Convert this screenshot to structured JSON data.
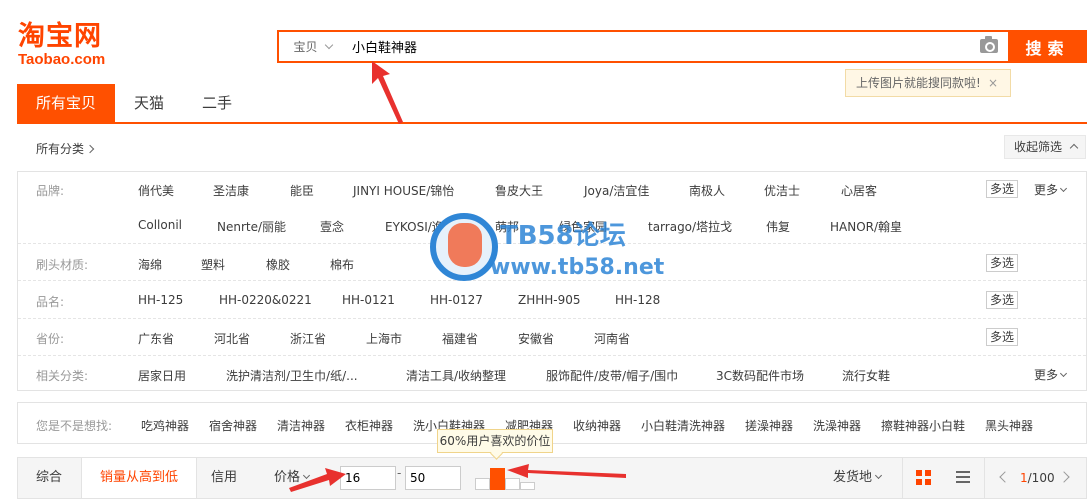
{
  "logo": {
    "cn": "淘宝网",
    "en": "Taobao.com"
  },
  "search": {
    "scope": "宝贝",
    "query": "小白鞋神器",
    "button": "搜索",
    "image_tip": "上传图片就能搜同款啦!",
    "tip_close": "×"
  },
  "tabs": [
    {
      "label": "所有宝贝",
      "active": true
    },
    {
      "label": "天猫",
      "active": false
    },
    {
      "label": "二手",
      "active": false
    }
  ],
  "breadcrumb": "所有分类",
  "collapse_label": "收起筛选",
  "filters": {
    "multi_label": "多选",
    "more_label": "更多",
    "brand": {
      "label": "品牌:",
      "row1": [
        "俏代美",
        "圣洁康",
        "能臣",
        "JINYI HOUSE/锦怡",
        "鲁皮大王",
        "Joya/洁宜佳",
        "南极人",
        "优洁士",
        "心居客"
      ],
      "row2": [
        "Collonil",
        "Nenrte/丽能",
        "壹念",
        "EYKOSI/逸柯",
        "萌邦",
        "绿色家园",
        "tarrago/塔拉戈",
        "伟复",
        "HANOR/翰皇"
      ]
    },
    "material": {
      "label": "刷头材质:",
      "items": [
        "海绵",
        "塑料",
        "橡胶",
        "棉布"
      ]
    },
    "product": {
      "label": "品名:",
      "items": [
        "HH-125",
        "HH-0220&0221",
        "HH-0121",
        "HH-0127",
        "ZHHH-905",
        "HH-128"
      ]
    },
    "province": {
      "label": "省份:",
      "items": [
        "广东省",
        "河北省",
        "浙江省",
        "上海市",
        "福建省",
        "安徽省",
        "河南省"
      ]
    },
    "category": {
      "label": "相关分类:",
      "items": [
        "居家日用",
        "洗护清洁剂/卫生巾/纸/...",
        "清洁工具/收纳整理",
        "服饰配件/皮带/帽子/围巾",
        "3C数码配件市场",
        "流行女鞋"
      ]
    }
  },
  "suggestions": {
    "label": "您是不是想找:",
    "items": [
      "吃鸡神器",
      "宿舍神器",
      "清洁神器",
      "衣柜神器",
      "洗小白鞋神器",
      "减肥神器",
      "收纳神器",
      "小白鞋清洗神器",
      "搓澡神器",
      "洗澡神器",
      "擦鞋神器小白鞋",
      "黑头神器"
    ]
  },
  "price_tooltip": "60%用户喜欢的价位",
  "sortbar": {
    "items": [
      "综合",
      "销量从高到低",
      "信用",
      "价格"
    ],
    "price_min": "16",
    "price_sep": "-",
    "price_max": "50",
    "ship_from": "发货地",
    "page_current": "1",
    "page_total": "/100"
  },
  "watermark": {
    "line1": "TB58论坛",
    "line2": "www.tb58.net"
  },
  "colors": {
    "accent": "#ff5000",
    "arrow": "#e8312e"
  }
}
